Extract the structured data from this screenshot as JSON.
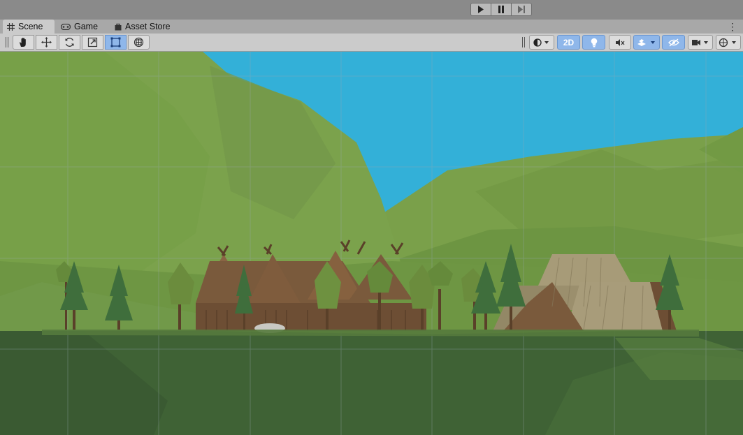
{
  "topbar": {
    "play_label": "Play",
    "pause_label": "Pause",
    "step_label": "Step"
  },
  "tabs": [
    {
      "label": "Scene",
      "icon": "grid-icon",
      "active": true
    },
    {
      "label": "Game",
      "icon": "gamepad-icon",
      "active": false
    },
    {
      "label": "Asset Store",
      "icon": "bag-icon",
      "active": false
    }
  ],
  "toolbar": {
    "tools": [
      {
        "name": "hand-tool",
        "icon": "hand-icon",
        "active": false
      },
      {
        "name": "move-tool",
        "icon": "move-icon",
        "active": false
      },
      {
        "name": "rotate-tool",
        "icon": "rotate-icon",
        "active": false
      },
      {
        "name": "scale-tool",
        "icon": "scale-icon",
        "active": false
      },
      {
        "name": "rect-tool",
        "icon": "rect-icon",
        "active": true
      },
      {
        "name": "transform-tool",
        "icon": "transform-icon",
        "active": false
      }
    ],
    "mode_2d_label": "2D",
    "lighting_on": true,
    "effects_on": true,
    "visibility_on": true
  },
  "colors": {
    "sky": "#33b0d8",
    "hill_light": "#7aa04a",
    "hill_mid": "#6e9443",
    "ground_dark": "#3f6235",
    "wood": "#7a5a3c",
    "thatch": "#a79b78",
    "pine": "#3f6e3c",
    "accent_blue": "#8fb7ea"
  }
}
